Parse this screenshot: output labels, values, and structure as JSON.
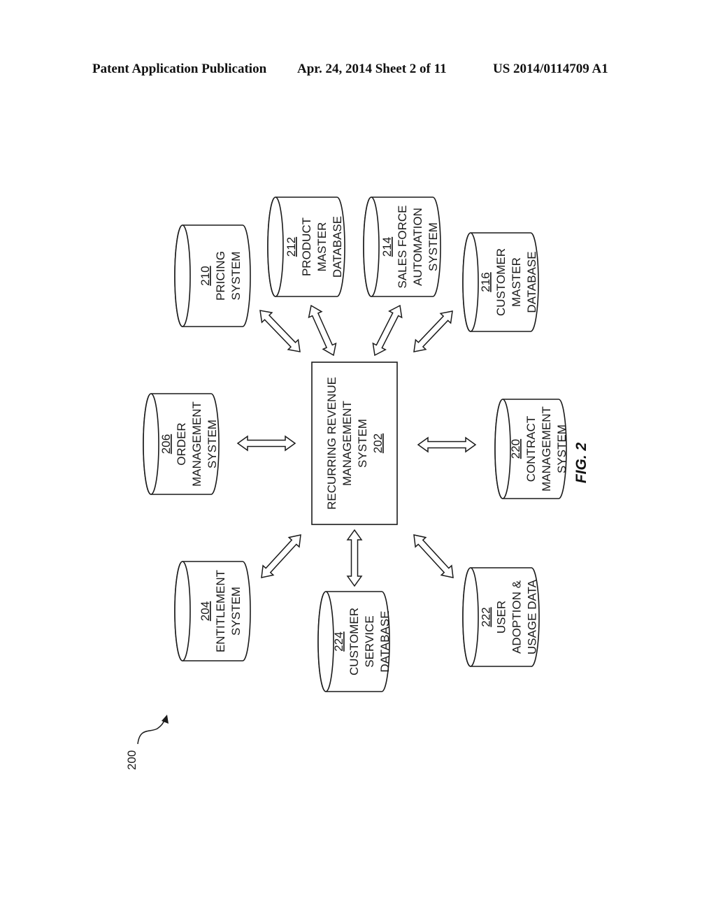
{
  "header": {
    "left": "Patent Application Publication",
    "middle": "Apr. 24, 2014  Sheet 2 of 11",
    "right": "US 2014/0114709 A1"
  },
  "figure": {
    "label": "FIG. 2",
    "reference_numeral": "200",
    "central": {
      "number": "202",
      "lines": [
        "RECURRING REVENUE",
        "MANAGEMENT",
        "SYSTEM"
      ]
    },
    "nodes": [
      {
        "id": "210",
        "number": "210",
        "lines": [
          "PRICING",
          "SYSTEM"
        ]
      },
      {
        "id": "212",
        "number": "212",
        "lines": [
          "PRODUCT",
          "MASTER",
          "DATABASE"
        ]
      },
      {
        "id": "214",
        "number": "214",
        "lines": [
          "SALES FORCE",
          "AUTOMATION",
          "SYSTEM"
        ]
      },
      {
        "id": "216",
        "number": "216",
        "lines": [
          "CUSTOMER",
          "MASTER",
          "DATABASE"
        ]
      },
      {
        "id": "206",
        "number": "206",
        "lines": [
          "ORDER",
          "MANAGEMENT",
          "SYSTEM"
        ]
      },
      {
        "id": "220",
        "number": "220",
        "lines": [
          "CONTRACT",
          "MANAGEMENT",
          "SYSTEM"
        ]
      },
      {
        "id": "204",
        "number": "204",
        "lines": [
          "ENTITLEMENT",
          "SYSTEM"
        ]
      },
      {
        "id": "224",
        "number": "224",
        "lines": [
          "CUSTOMER",
          "SERVICE",
          "DATABASE"
        ]
      },
      {
        "id": "222",
        "number": "222",
        "lines": [
          "USER",
          "ADOPTION &",
          "USAGE DATA"
        ]
      }
    ],
    "connections": [
      {
        "from": "202",
        "to": "210",
        "type": "bidirectional"
      },
      {
        "from": "202",
        "to": "212",
        "type": "bidirectional"
      },
      {
        "from": "202",
        "to": "214",
        "type": "bidirectional"
      },
      {
        "from": "202",
        "to": "216",
        "type": "bidirectional"
      },
      {
        "from": "202",
        "to": "206",
        "type": "bidirectional"
      },
      {
        "from": "202",
        "to": "220",
        "type": "bidirectional"
      },
      {
        "from": "202",
        "to": "204",
        "type": "bidirectional"
      },
      {
        "from": "202",
        "to": "224",
        "type": "bidirectional"
      },
      {
        "from": "202",
        "to": "222",
        "type": "bidirectional"
      }
    ]
  }
}
